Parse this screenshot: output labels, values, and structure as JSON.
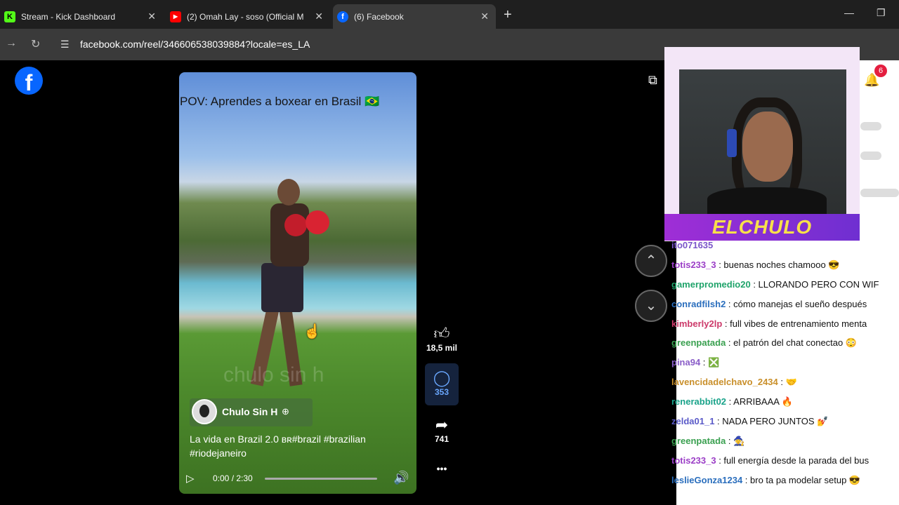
{
  "browser": {
    "tabs": [
      {
        "title": "Stream - Kick Dashboard",
        "favicon": "kick-icon",
        "active": false
      },
      {
        "title": "(2) Omah Lay - soso (Official M",
        "favicon": "youtube-icon",
        "active": false
      },
      {
        "title": "(6) Facebook",
        "favicon": "facebook-icon",
        "active": true
      }
    ],
    "new_tab": "+",
    "url": "facebook.com/reel/346606538039884?locale=es_LA"
  },
  "reel": {
    "overlay_title": "POV: Aprendes a boxear en Brasil 🇧🇷",
    "watermark": "chulo sin h",
    "author": "Chulo Sin H",
    "caption": "La vida en Brazil 2.0 ʙʀ#brazil #brazilian #riodejaneiro",
    "time": "0:00 / 2:30",
    "progress": 0
  },
  "actions": {
    "likes": "18,5 mil",
    "comments": "353",
    "shares": "741",
    "more": "•••"
  },
  "notifications": {
    "badge": "6"
  },
  "stream_overlay": {
    "brand": "ELCHULO"
  },
  "chat": [
    {
      "user": "ito071635",
      "text": "",
      "color": "#7a55c9"
    },
    {
      "user": "totis233_3",
      "text": ": buenas noches chamooo 😎",
      "color": "#9b3ec7"
    },
    {
      "user": "gamerpromedio20",
      "text": ": LLORANDO PERO CON WIF",
      "color": "#1fa36a"
    },
    {
      "user": "conradfilsh2",
      "text": ": cómo manejas el sueño después",
      "color": "#2a6ebd"
    },
    {
      "user": "kimberly2lp",
      "text": ": full vibes de entrenamiento menta",
      "color": "#cc3a6a"
    },
    {
      "user": "greenpatada",
      "text": ": el patrón del chat conectao 😳",
      "color": "#3aa050"
    },
    {
      "user": "pina94",
      "text": ": ❎",
      "color": "#8a5ec8"
    },
    {
      "user": "lavencidadelchavo_2434",
      "text": ": 🤝",
      "color": "#c98f2a"
    },
    {
      "user": "renerabbit02",
      "text": ": ARRIBAAA 🔥",
      "color": "#1aa38a"
    },
    {
      "user": "zelda01_1",
      "text": ": NADA PERO JUNTOS 💅",
      "color": "#5a5ac8"
    },
    {
      "user": "greenpatada",
      "text": ": 🧙",
      "color": "#3aa050"
    },
    {
      "user": "totis233_3",
      "text": ": full energía desde la parada del bus",
      "color": "#9b3ec7"
    },
    {
      "user": "leslieGonza1234",
      "text": ": bro ta pa modelar setup 😎",
      "color": "#2a6ebd"
    }
  ]
}
